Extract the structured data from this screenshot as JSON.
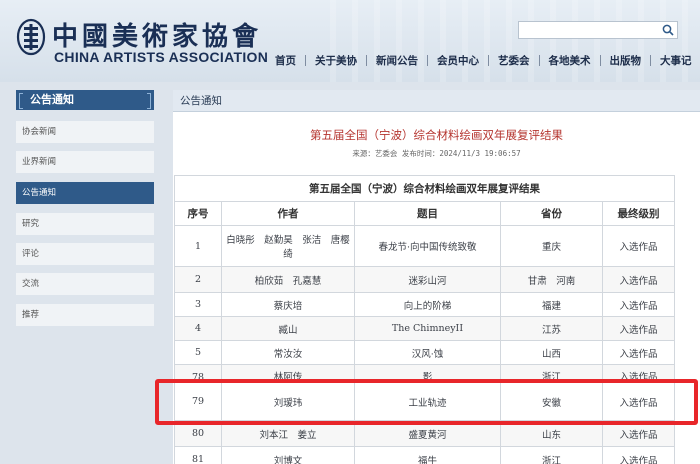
{
  "site": {
    "name_cn": "中國美術家協會",
    "name_en": "CHINA ARTISTS ASSOCIATION"
  },
  "search": {
    "placeholder": ""
  },
  "nav": [
    "首页",
    "关于美协",
    "新闻公告",
    "会员中心",
    "艺委会",
    "各地美术",
    "出版物",
    "大事记"
  ],
  "sidebar": {
    "title": "公告通知",
    "items": [
      {
        "label": "协会新闻",
        "active": false
      },
      {
        "label": "业界新闻",
        "active": false
      },
      {
        "label": "公告通知",
        "active": true
      },
      {
        "label": "研究",
        "active": false
      },
      {
        "label": "评论",
        "active": false
      },
      {
        "label": "交流",
        "active": false
      },
      {
        "label": "推荐",
        "active": false
      }
    ]
  },
  "main": {
    "section_title": "公告通知",
    "article_title": "第五届全国（宁波）综合材料绘画双年展复评结果",
    "article_meta": "来源：艺委会  发布时间：2024/11/3 19:06:57",
    "table": {
      "caption": "第五届全国（宁波）综合材料绘画双年展复评结果",
      "headers": [
        "序号",
        "作者",
        "题目",
        "省份",
        "最终级别"
      ],
      "rows": [
        [
          "1",
          "白晓彤　赵勤昊　张洁　唐樱绮",
          "春龙节·向中国传统致敬",
          "重庆",
          "入选作品"
        ],
        [
          "2",
          "柏欣茹　孔嘉慧",
          "迷彩山河",
          "甘肃　河南",
          "入选作品"
        ],
        [
          "3",
          "蔡庆培",
          "向上的阶梯",
          "福建",
          "入选作品"
        ],
        [
          "4",
          "臧山",
          "The ChimneyII",
          "江苏",
          "入选作品"
        ],
        [
          "5",
          "常汝汝",
          "汉风·蚀",
          "山西",
          "入选作品"
        ],
        [
          "78",
          "林阿传",
          "影",
          "浙江",
          "入选作品"
        ],
        [
          "79",
          "刘瑷玮",
          "工业轨迹",
          "安徽",
          "入选作品"
        ],
        [
          "80",
          "刘本江　姜立",
          "盛夏黄河",
          "山东",
          "入选作品"
        ],
        [
          "81",
          "刘博文",
          "福牛",
          "浙江",
          "入选作品"
        ]
      ]
    }
  },
  "colors": {
    "accent": "#2f5a89",
    "title_red": "#b5352f",
    "highlight": "#e8262a"
  }
}
